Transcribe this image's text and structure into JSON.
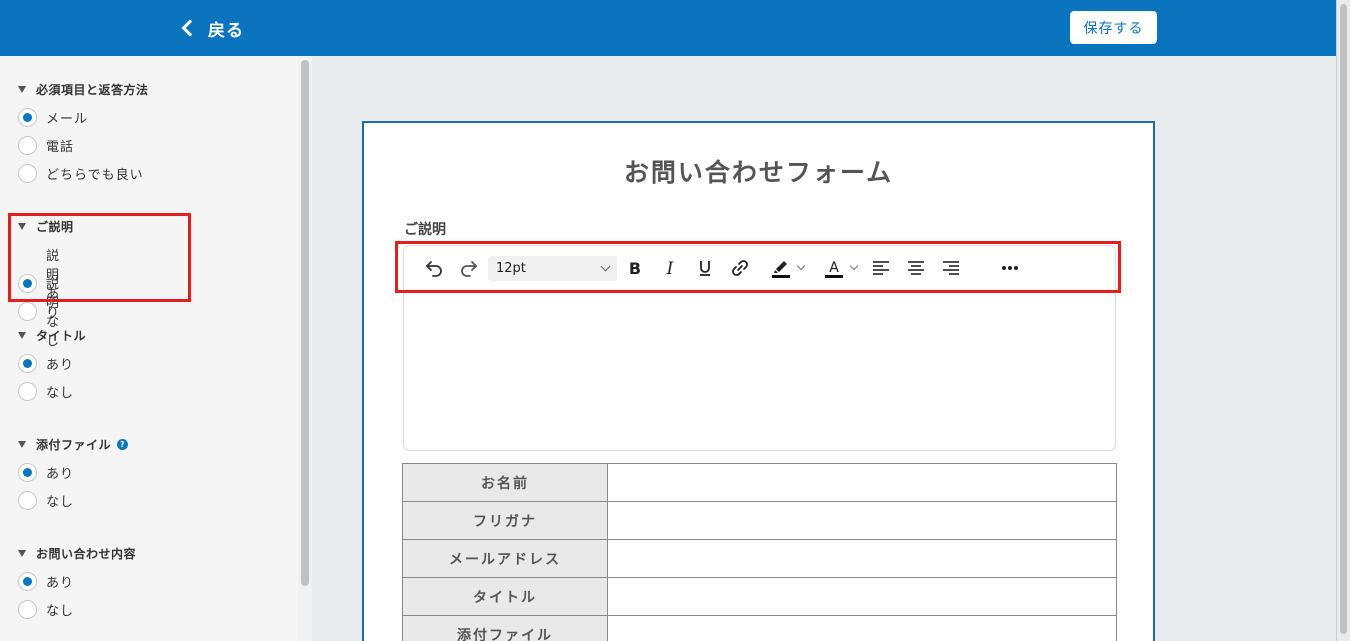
{
  "header": {
    "back_label": "戻る",
    "save_label": "保存する"
  },
  "sidebar": {
    "sections": [
      {
        "title": "必須項目と返答方法",
        "options": [
          {
            "label": "メール",
            "selected": true
          },
          {
            "label": "電話",
            "selected": false
          },
          {
            "label": "どちらでも良い",
            "selected": false
          }
        ]
      },
      {
        "title": "ご説明",
        "options": [
          {
            "label": "説明あり",
            "selected": true
          },
          {
            "label": "説明なし",
            "selected": false
          }
        ]
      },
      {
        "title": "タイトル",
        "options": [
          {
            "label": "あり",
            "selected": true
          },
          {
            "label": "なし",
            "selected": false
          }
        ]
      },
      {
        "title": "添付ファイル",
        "help": "?",
        "options": [
          {
            "label": "あり",
            "selected": true
          },
          {
            "label": "なし",
            "selected": false
          }
        ]
      },
      {
        "title": "お問い合わせ内容",
        "options": [
          {
            "label": "あり",
            "selected": true
          },
          {
            "label": "なし",
            "selected": false
          }
        ]
      }
    ]
  },
  "form": {
    "title": "お問い合わせフォーム",
    "description_label": "ご説明",
    "toolbar": {
      "font_size": "12pt",
      "icons": [
        "undo-icon",
        "redo-icon",
        "bold-icon",
        "italic-icon",
        "underline-icon",
        "link-icon",
        "highlight-icon",
        "text-color-icon",
        "align-left-icon",
        "align-center-icon",
        "align-right-icon",
        "more-icon"
      ]
    },
    "fields": [
      {
        "label": "お名前"
      },
      {
        "label": "フリガナ"
      },
      {
        "label": "メールアドレス"
      },
      {
        "label": "タイトル"
      },
      {
        "label": "添付ファイル"
      }
    ]
  },
  "colors": {
    "header_bg": "#0a74bf",
    "accent": "#0a74bf",
    "highlight_box": "#e02020"
  }
}
